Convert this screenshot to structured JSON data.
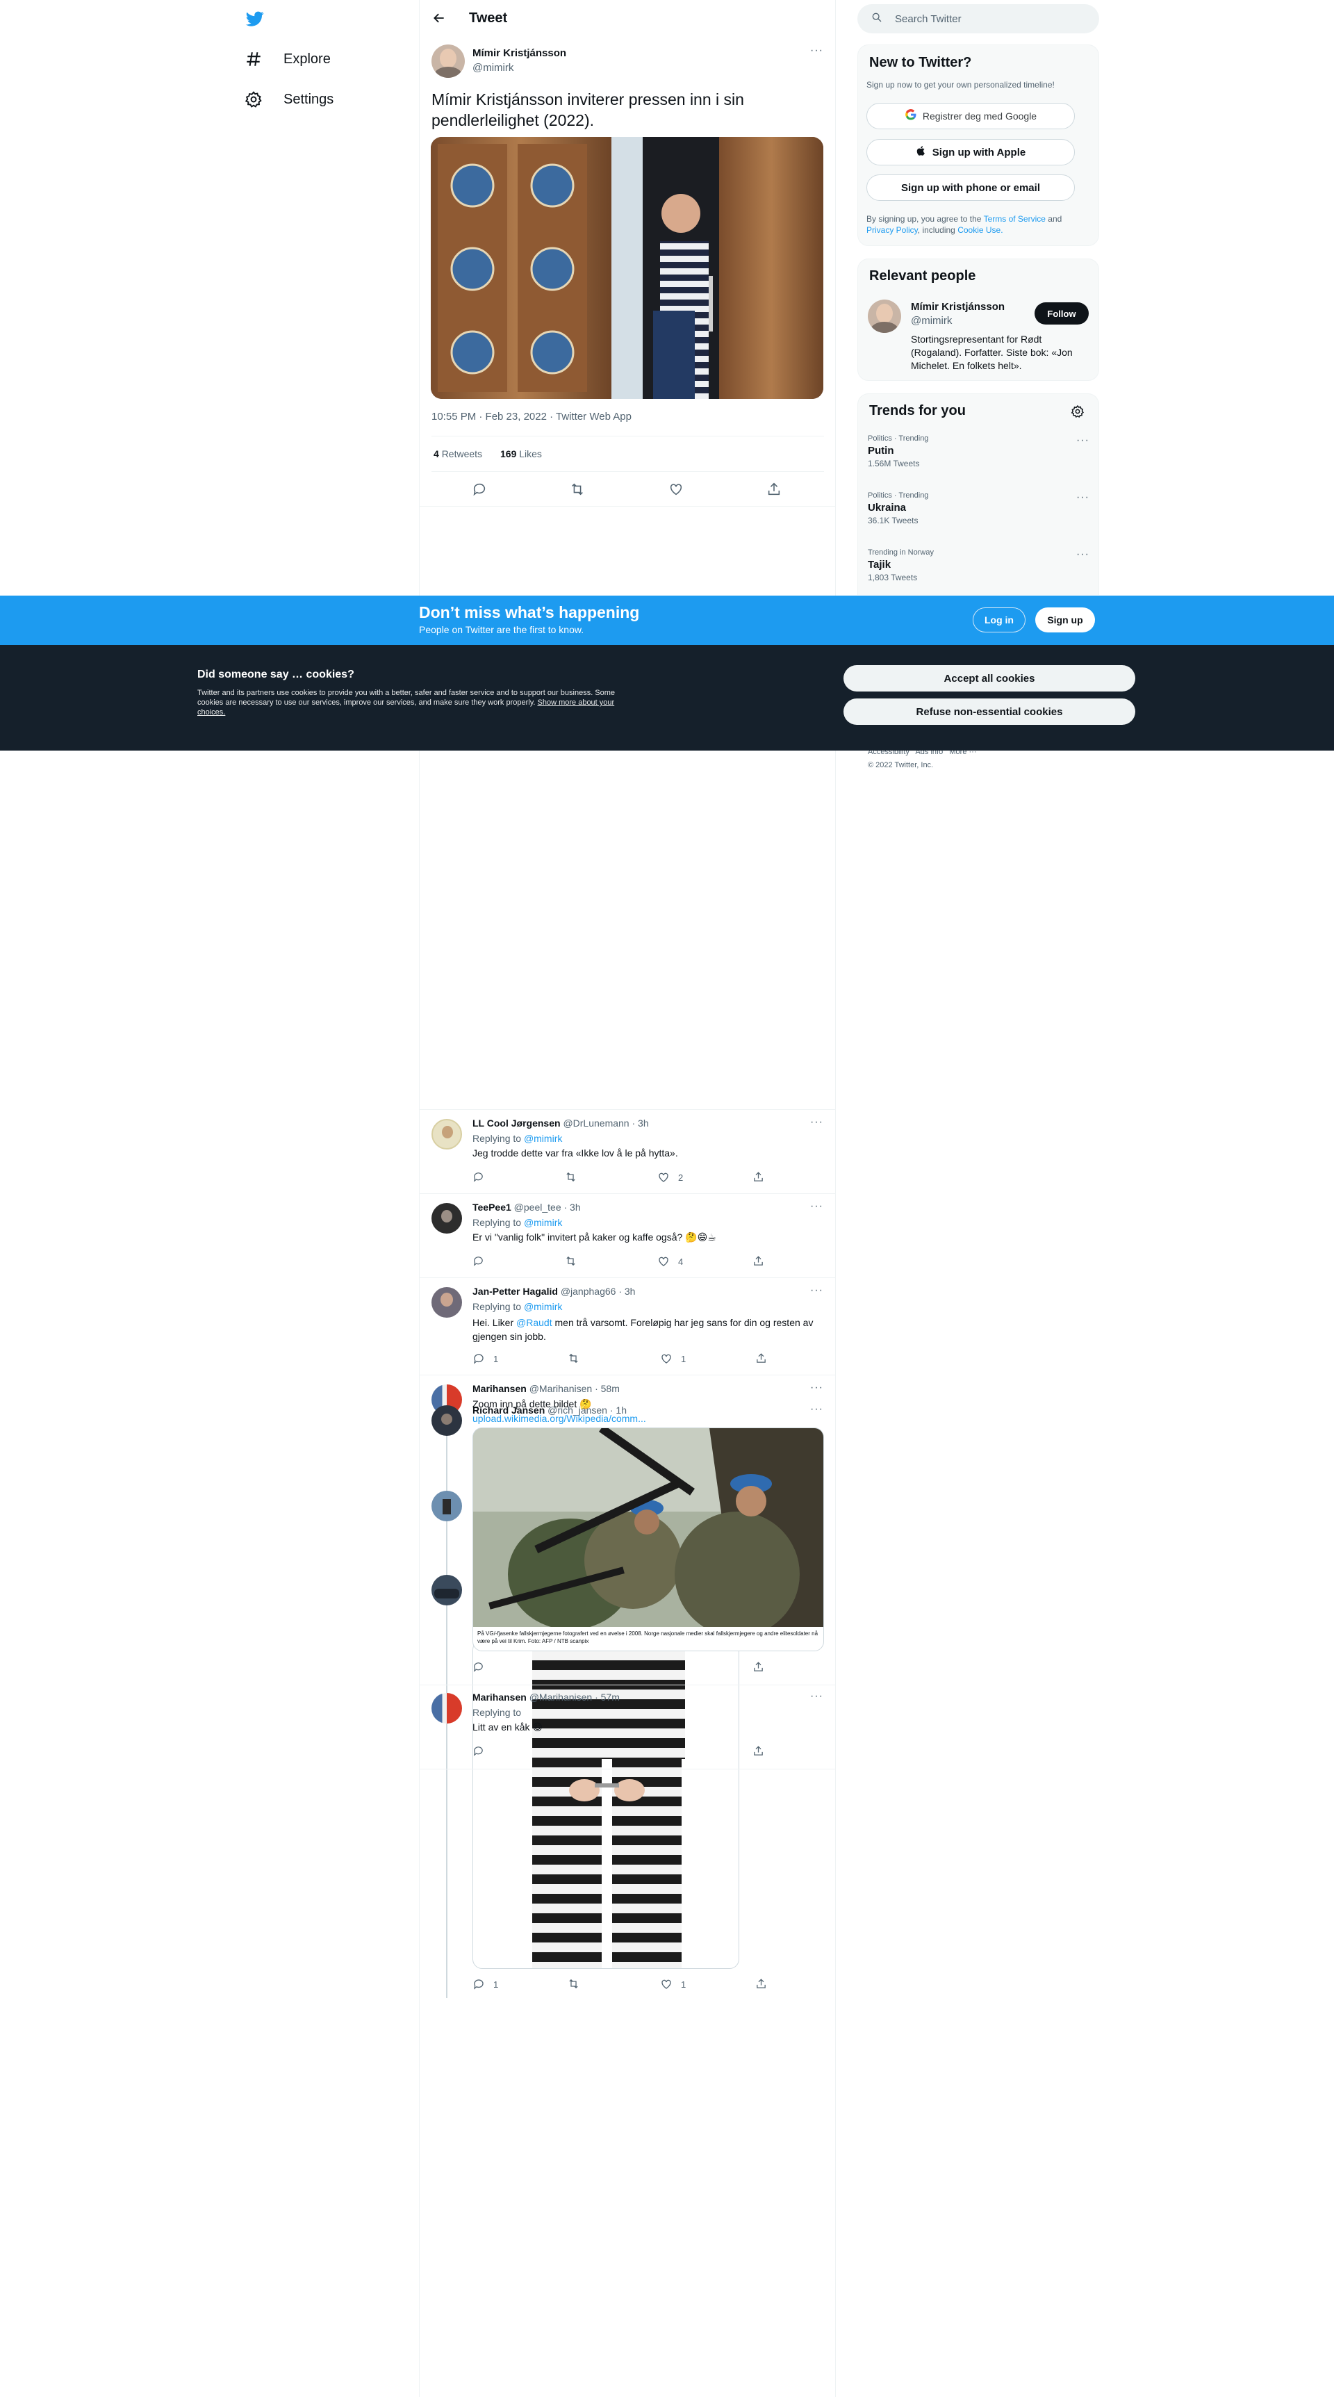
{
  "nav": {
    "explore": "Explore",
    "settings": "Settings"
  },
  "header": {
    "title": "Tweet"
  },
  "tweet": {
    "author_name": "Mímir Kristjánsson",
    "author_handle": "@mimirk",
    "text": "Mímir Kristjánsson inviterer pressen inn i sin pendlerleilighet (2022).",
    "timestamp": "10:55 PM · Feb 23, 2022 · Twitter Web App",
    "retweets_count": "4",
    "retweets_label": "Retweets",
    "likes_count": "169",
    "likes_label": "Likes"
  },
  "search": {
    "placeholder": "Search Twitter"
  },
  "signup_card": {
    "title": "New to Twitter?",
    "subtitle": "Sign up now to get your own personalized timeline!",
    "google": "Registrer deg med Google",
    "apple": "Sign up with Apple",
    "phone": "Sign up with phone or email",
    "terms_prefix": "By signing up, you agree to the",
    "terms_link": "Terms of Service",
    "terms_and": "and",
    "privacy_link": "Privacy Policy",
    "including": ", including",
    "cookie_link": "Cookie Use."
  },
  "relevant": {
    "title": "Relevant people",
    "name": "Mímir Kristjánsson",
    "handle": "@mimirk",
    "follow": "Follow",
    "bio": "Stortingsrepresentant for Rødt (Rogaland). Forfatter. Siste bok: «Jon Michelet. En folkets helt»."
  },
  "trends": {
    "title": "Trends for you",
    "items": [
      {
        "context": "Politics · Trending",
        "name": "Putin",
        "count": "1.56M Tweets"
      },
      {
        "context": "Politics · Trending",
        "name": "Ukraina",
        "count": "36.1K Tweets"
      },
      {
        "context": "Trending in Norway",
        "name": "Tajik",
        "count": "1,803 Tweets"
      }
    ]
  },
  "footer": {
    "links": "Accessibility   Ads info   More ···",
    "copyright": "© 2022 Twitter, Inc."
  },
  "banner": {
    "title": "Don’t miss what’s happening",
    "subtitle": "People on Twitter are the first to know.",
    "login": "Log in",
    "signup": "Sign up"
  },
  "cookies": {
    "title": "Did someone say … cookies?",
    "body": "Twitter and its partners use cookies to provide you with a better, safer and faster service and to support our business. Some cookies are necessary to use our services, improve our services, and make sure they work properly.",
    "link": "Show more about your choices.",
    "accept": "Accept all cookies",
    "refuse": "Refuse non-essential cookies"
  },
  "replies": [
    {
      "name": "LL Cool Jørgensen",
      "meta": "@DrLunemann · 3h",
      "replying": "Replying to",
      "to": "@mimirk",
      "text": "Jeg trodde dette var fra «Ikke lov å le på hytta».",
      "likes": "2"
    },
    {
      "name": "TeePee1",
      "meta": "@peel_tee · 3h",
      "replying": "Replying to",
      "to": "@mimirk",
      "text": "Er vi \"vanlig folk\" invitert på kaker og kaffe også? 🤔😄☕",
      "likes": "4"
    },
    {
      "name": "Jan-Petter Hagalid",
      "meta": "@janphag66 · 3h",
      "replying": "Replying to",
      "to": "@mimirk",
      "text_a": "Hei. Liker",
      "mention": "@Raudt",
      "text_b": "men trå varsomt. Foreløpig har jeg sans for din og resten av gjengen sin jobb.",
      "retweets": "",
      "likes": "1",
      "replies_count": "1"
    },
    {
      "name": "Marihansen",
      "meta": "@Marihanisen · 58m",
      "text": "Zoom inn på dette bildet 🤔"
    },
    {
      "name": "Richard Jansen",
      "meta": "@rich_jansen · 1h",
      "link": "upload.wikimedia.org/Wikipedia/comm...",
      "caption": "På VG/-fjasenke fallskjermjegerne fotografert ved en øvelse i 2008. Norge nasjonale medier skal fallskjermjegere og andre elitesoldater nå være på vei til Krim. Foto: AFP / NTB scanpix"
    },
    {
      "name": "Marihansen",
      "meta": "@Marihanisen · 57m",
      "replying": "Replying to",
      "to": "",
      "text": "Litt av en kåk 😄",
      "replies_count": "1",
      "likes": "1"
    }
  ]
}
